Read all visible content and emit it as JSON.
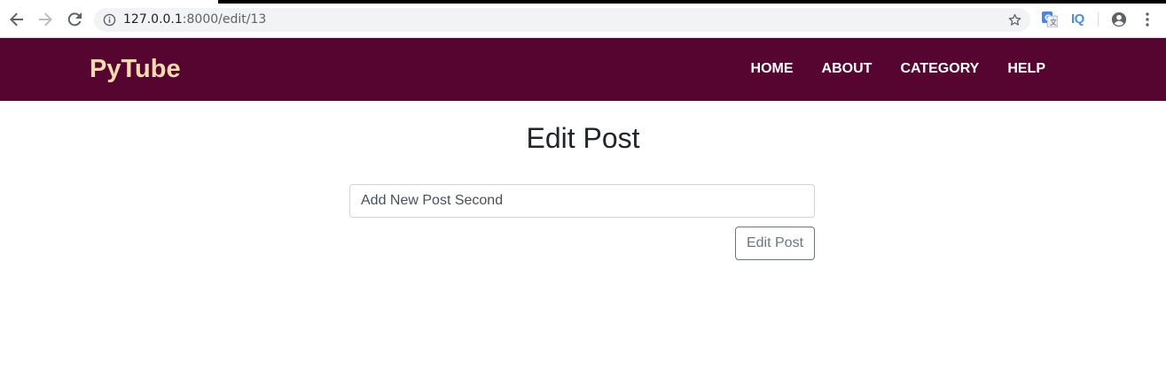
{
  "browser": {
    "url_host": "127.0.0.1",
    "url_rest": ":8000/edit/13",
    "extension_label": "IQ"
  },
  "navbar": {
    "brand": "PyTube",
    "links": [
      "HOME",
      "ABOUT",
      "CATEGORY",
      "HELP"
    ]
  },
  "main": {
    "title": "Edit Post",
    "input_value": "Add New Post Second",
    "submit_label": "Edit Post"
  },
  "colors": {
    "navbar_bg": "#550530",
    "brand": "#f6dcac",
    "button_border": "#6c757d"
  },
  "icons": {
    "back": "back-arrow-icon",
    "forward": "forward-arrow-icon",
    "reload": "reload-icon",
    "info": "info-icon",
    "star": "star-icon",
    "translate": "translate-icon",
    "profile": "profile-icon",
    "menu": "kebab-menu-icon"
  }
}
